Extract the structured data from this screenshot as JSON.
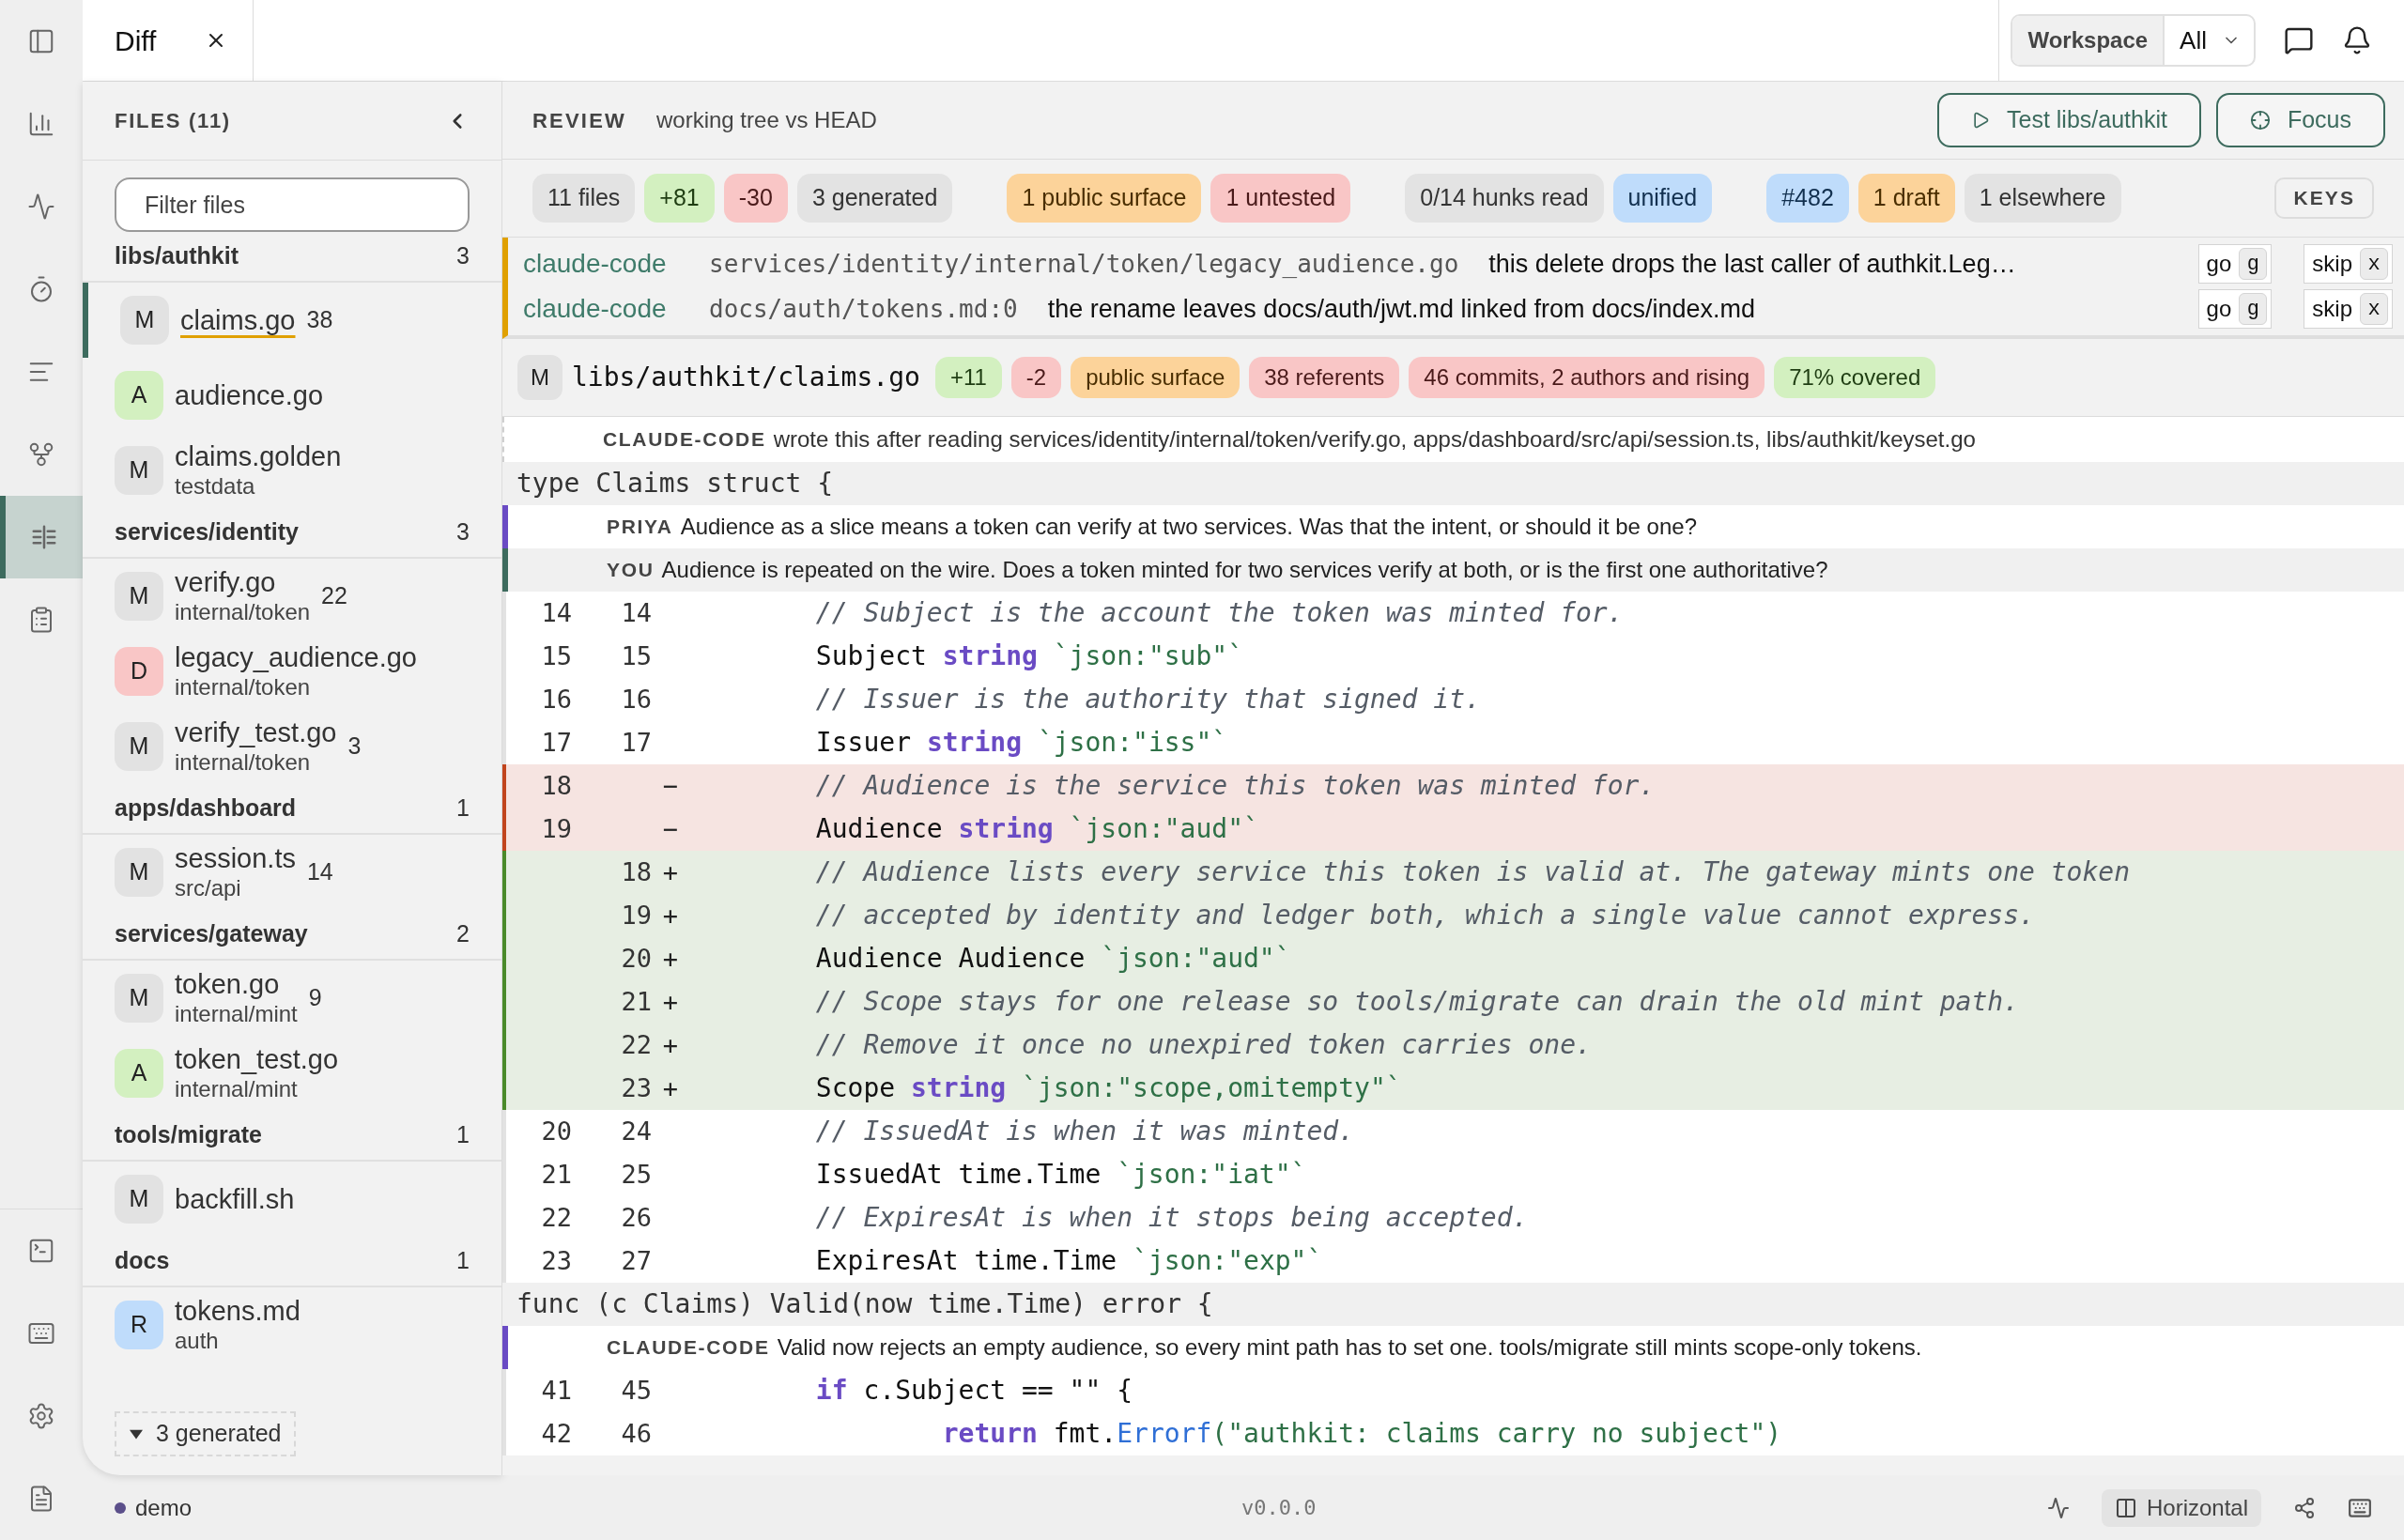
{
  "rail": {
    "top": [
      {
        "kind": "panel",
        "selected": false
      },
      {
        "kind": "chart",
        "selected": false
      },
      {
        "kind": "pulse",
        "selected": false
      },
      {
        "kind": "timer",
        "selected": false
      },
      {
        "kind": "lines",
        "selected": false
      },
      {
        "kind": "branch",
        "selected": false
      },
      {
        "kind": "diff",
        "selected": true
      },
      {
        "kind": "clipboard",
        "selected": false
      }
    ],
    "bottom": [
      {
        "kind": "terminal",
        "selected": false
      },
      {
        "kind": "keyboard",
        "selected": false
      },
      {
        "kind": "settings",
        "selected": false
      },
      {
        "kind": "file",
        "selected": false
      }
    ]
  },
  "tabs": [
    {
      "label": "Diff",
      "selected": true
    }
  ],
  "workspace": {
    "label": "Workspace",
    "value": "All"
  },
  "files_panel": {
    "title": "FILES (11)",
    "filter": {
      "placeholder": "Filter files"
    },
    "groups": [
      {
        "name": "libs/authkit",
        "count": "3",
        "files": [
          {
            "kind": "modified",
            "status": "M",
            "name": "claims.go",
            "count": "38",
            "selected": true,
            "flagged": true
          },
          {
            "kind": "added",
            "status": "A",
            "name": "audience.go",
            "selected": false,
            "flagged": false
          },
          {
            "kind": "modified",
            "status": "M",
            "name": "claims.golden",
            "dir": "testdata",
            "selected": false,
            "flagged": false
          }
        ]
      },
      {
        "name": "services/identity",
        "count": "3",
        "files": [
          {
            "kind": "modified",
            "status": "M",
            "name": "verify.go",
            "dir": "internal/token",
            "count": "22",
            "selected": false,
            "flagged": false
          },
          {
            "kind": "deleted",
            "status": "D",
            "name": "legacy_audience.go",
            "dir": "internal/token",
            "selected": false,
            "flagged": false
          },
          {
            "kind": "modified",
            "status": "M",
            "name": "verify_test.go",
            "dir": "internal/token",
            "count": "3",
            "selected": false,
            "flagged": false
          }
        ]
      },
      {
        "name": "apps/dashboard",
        "count": "1",
        "files": [
          {
            "kind": "modified",
            "status": "M",
            "name": "session.ts",
            "dir": "src/api",
            "count": "14",
            "selected": false,
            "flagged": false
          }
        ]
      },
      {
        "name": "services/gateway",
        "count": "2",
        "files": [
          {
            "kind": "modified",
            "status": "M",
            "name": "token.go",
            "dir": "internal/mint",
            "count": "9",
            "selected": false,
            "flagged": false
          },
          {
            "kind": "added",
            "status": "A",
            "name": "token_test.go",
            "dir": "internal/mint",
            "selected": false,
            "flagged": false
          }
        ]
      },
      {
        "name": "tools/migrate",
        "count": "1",
        "files": [
          {
            "kind": "modified",
            "status": "M",
            "name": "backfill.sh",
            "selected": false,
            "flagged": false
          }
        ]
      },
      {
        "name": "docs",
        "count": "1",
        "files": [
          {
            "kind": "renamed",
            "status": "R",
            "name": "tokens.md",
            "dir": "auth",
            "selected": false,
            "flagged": false
          }
        ]
      }
    ],
    "generated": {
      "label": "3 generated",
      "expanded": true
    }
  },
  "review": {
    "title": "REVIEW",
    "subtitle": "working tree vs HEAD",
    "buttons": [
      {
        "kind": "play",
        "label": "Test libs/authkit"
      },
      {
        "kind": "focus",
        "label": "Focus"
      }
    ]
  },
  "chip_groups": [
    [
      {
        "kind": "neutral",
        "label": "11 files"
      },
      {
        "kind": "added",
        "label": "+81"
      },
      {
        "kind": "removed",
        "label": "-30"
      },
      {
        "kind": "neutral",
        "label": "3 generated"
      }
    ],
    [
      {
        "kind": "warning",
        "label": "1 public surface"
      },
      {
        "kind": "removed",
        "label": "1 untested"
      }
    ],
    [
      {
        "kind": "neutral",
        "label": "0/14 hunks read"
      },
      {
        "kind": "info",
        "label": "unified"
      }
    ],
    [
      {
        "kind": "info",
        "label": "#482"
      },
      {
        "kind": "warning",
        "label": "1 draft"
      },
      {
        "kind": "neutral",
        "label": "1 elsewhere"
      }
    ]
  ],
  "keys_button": "KEYS",
  "notes": [
    {
      "author": "claude-code",
      "location": "services/identity/internal/token/legacy_audience.go",
      "text": "this delete drops the last caller of authkit.Leg…",
      "actions": [
        {
          "label": "go",
          "key": "g"
        },
        {
          "label": "skip",
          "key": "x"
        }
      ]
    },
    {
      "author": "claude-code",
      "location": "docs/auth/tokens.md:0",
      "text": "the rename leaves docs/auth/jwt.md linked from docs/index.md",
      "actions": [
        {
          "label": "go",
          "key": "g"
        },
        {
          "label": "skip",
          "key": "x"
        }
      ]
    }
  ],
  "file_header": {
    "status": "M",
    "path": "libs/authkit/claims.go",
    "chips": [
      {
        "kind": "added",
        "label": "+11"
      },
      {
        "kind": "removed",
        "label": "-2"
      },
      {
        "kind": "warning",
        "label": "public surface"
      },
      {
        "kind": "removed",
        "label": "38 referents"
      },
      {
        "kind": "removed",
        "label": "46 commits, 2 authors and rising"
      },
      {
        "kind": "added",
        "label": "71% covered"
      }
    ]
  },
  "provenance": {
    "author": "CLAUDE-CODE",
    "text": "wrote this after reading services/identity/internal/token/verify.go, apps/dashboard/src/api/session.ts, libs/authkit/keyset.go"
  },
  "lines": [
    {
      "kind": "hunk",
      "text": "type Claims struct {"
    },
    {
      "kind": "comment",
      "author": "PRIYA",
      "text": "Audience as a slice means a token can verify at two services. Was that the intent, or should it be one?",
      "color": "#6a4bc4",
      "mine": false
    },
    {
      "kind": "comment",
      "author": "YOU",
      "text": "Audience is repeated on the wire. Does a token minted for two services verify at both, or is the first one authoritative?",
      "color": "#3d6b5e",
      "mine": true
    },
    {
      "kind": "context",
      "old": "14",
      "new": "14",
      "tokens": [
        {
          "kind": "comment",
          "text": "\t// Subject is the account the token was minted for."
        }
      ]
    },
    {
      "kind": "context",
      "old": "15",
      "new": "15",
      "tokens": [
        {
          "kind": "plain",
          "text": "\tSubject "
        },
        {
          "kind": "keyword",
          "text": "string"
        },
        {
          "kind": "string",
          "text": " `json:\"sub\"`"
        }
      ]
    },
    {
      "kind": "context",
      "old": "16",
      "new": "16",
      "tokens": [
        {
          "kind": "comment",
          "text": "\t// Issuer is the authority that signed it."
        }
      ]
    },
    {
      "kind": "context",
      "old": "17",
      "new": "17",
      "tokens": [
        {
          "kind": "plain",
          "text": "\tIssuer "
        },
        {
          "kind": "keyword",
          "text": "string"
        },
        {
          "kind": "string",
          "text": " `json:\"iss\"`"
        }
      ]
    },
    {
      "kind": "removed",
      "old": "18",
      "marker": "−",
      "tokens": [
        {
          "kind": "comment",
          "text": "\t// Audience is the service this token was minted for."
        }
      ]
    },
    {
      "kind": "removed",
      "old": "19",
      "marker": "−",
      "tokens": [
        {
          "kind": "plain",
          "text": "\tAudience "
        },
        {
          "kind": "keyword",
          "text": "string"
        },
        {
          "kind": "string",
          "text": " `json:\"aud\"`"
        }
      ]
    },
    {
      "kind": "added",
      "new": "18",
      "marker": "+",
      "tokens": [
        {
          "kind": "comment",
          "text": "\t// Audience lists every service this token is valid at. The gateway mints one token"
        }
      ]
    },
    {
      "kind": "added",
      "new": "19",
      "marker": "+",
      "tokens": [
        {
          "kind": "comment",
          "text": "\t// accepted by identity and ledger both, which a single value cannot express."
        }
      ]
    },
    {
      "kind": "added",
      "new": "20",
      "marker": "+",
      "tokens": [
        {
          "kind": "plain",
          "text": "\tAudience Audience "
        },
        {
          "kind": "string",
          "text": "`json:\"aud\"`"
        }
      ]
    },
    {
      "kind": "added",
      "new": "21",
      "marker": "+",
      "tokens": [
        {
          "kind": "comment",
          "text": "\t// Scope stays for one release so tools/migrate can drain the old mint path."
        }
      ]
    },
    {
      "kind": "added",
      "new": "22",
      "marker": "+",
      "tokens": [
        {
          "kind": "comment",
          "text": "\t// Remove it once no unexpired token carries one."
        }
      ]
    },
    {
      "kind": "added",
      "new": "23",
      "marker": "+",
      "tokens": [
        {
          "kind": "plain",
          "text": "\tScope "
        },
        {
          "kind": "keyword",
          "text": "string"
        },
        {
          "kind": "string",
          "text": " `json:\"scope,omitempty\"`"
        }
      ]
    },
    {
      "kind": "context",
      "old": "20",
      "new": "24",
      "tokens": [
        {
          "kind": "comment",
          "text": "\t// IssuedAt is when it was minted."
        }
      ]
    },
    {
      "kind": "context",
      "old": "21",
      "new": "25",
      "tokens": [
        {
          "kind": "plain",
          "text": "\tIssuedAt time.Time "
        },
        {
          "kind": "string",
          "text": "`json:\"iat\"`"
        }
      ]
    },
    {
      "kind": "context",
      "old": "22",
      "new": "26",
      "tokens": [
        {
          "kind": "comment",
          "text": "\t// ExpiresAt is when it stops being accepted."
        }
      ]
    },
    {
      "kind": "context",
      "old": "23",
      "new": "27",
      "tokens": [
        {
          "kind": "plain",
          "text": "\tExpiresAt time.Time "
        },
        {
          "kind": "string",
          "text": "`json:\"exp\"`"
        }
      ]
    },
    {
      "kind": "hunk",
      "text": "func (c Claims) Valid(now time.Time) error {"
    },
    {
      "kind": "comment",
      "author": "CLAUDE-CODE",
      "text": "Valid now rejects an empty audience, so every mint path has to set one. tools/migrate still mints scope-only tokens.",
      "color": "#6a4bc4",
      "mine": false
    },
    {
      "kind": "context",
      "old": "41",
      "new": "45",
      "tokens": [
        {
          "kind": "keyword",
          "text": "\tif"
        },
        {
          "kind": "plain",
          "text": " c.Subject == \"\" {"
        }
      ]
    },
    {
      "kind": "context",
      "old": "42",
      "new": "46",
      "tokens": [
        {
          "kind": "keyword",
          "text": "\t\treturn"
        },
        {
          "kind": "plain",
          "text": " fmt."
        },
        {
          "kind": "func",
          "text": "Errorf"
        },
        {
          "kind": "string",
          "text": "(\"authkit: claims carry no subject\")"
        }
      ]
    }
  ],
  "status_bar": {
    "workspace": "demo",
    "version": "v0.0.0",
    "layout_button": "Horizontal"
  }
}
